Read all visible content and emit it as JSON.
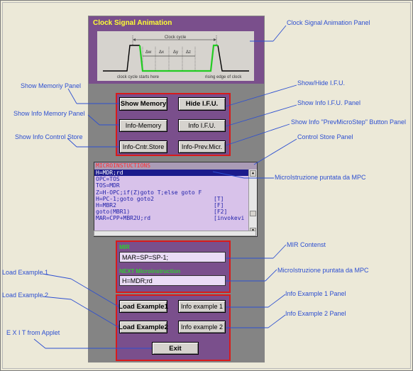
{
  "clock_panel": {
    "title": "Clock Signal Animation",
    "cycle_label": "Clock cycle",
    "delta_labels": [
      "Δw",
      "Δx",
      "Δy",
      "Δz"
    ],
    "start_label": "clock cycle starts here",
    "edge_label": "rising edge of clock"
  },
  "buttons": {
    "show_memory": "Show Memory",
    "hide_ifu": "Hide I.F.U.",
    "info_memory": "Info-Memory",
    "info_ifu": "Info I.F.U.",
    "info_cntr_store": "Info-Cntr.Store",
    "info_prev_micr": "Info-Prev.Micr.",
    "load_example1": "Load Example1",
    "info_example1": "Info example 1",
    "load_example2": "Load Example2",
    "info_example2": "Info example 2",
    "exit": "Exit"
  },
  "control_store": {
    "header": "MICROINSTUCTIONS",
    "rows": [
      {
        "text": "H=MDR;rd",
        "tag": "",
        "selected": true
      },
      {
        "text": "OPC=TOS",
        "tag": "",
        "selected": false
      },
      {
        "text": "TOS=MDR",
        "tag": "",
        "selected": false
      },
      {
        "text": "Z=H-OPC;if(Z)goto T;else goto F",
        "tag": "",
        "selected": false
      },
      {
        "text": "H=PC-1;goto goto2",
        "tag": "[T]",
        "selected": false
      },
      {
        "text": "H=MBR2",
        "tag": "[F]",
        "selected": false
      },
      {
        "text": "goto(MBR1)",
        "tag": "[F2]",
        "selected": false
      },
      {
        "text": "MAR=CPP+MBR2U;rd",
        "tag": "[invokevi",
        "selected": false
      }
    ]
  },
  "mir": {
    "label": "MIR",
    "value": "MAR=SP=SP-1;"
  },
  "next_micro": {
    "label": "NEXT Microinstruction",
    "value": "H=MDR;rd"
  },
  "annotations": {
    "clock_panel": "Clock Signal Animation Panel",
    "show_memory_panel": "Show Memoriy Panel",
    "show_hide_ifu": "Show/Hide I.F.U.",
    "show_info_memory_panel": "Show Info Memory Panel",
    "show_info_ifu_panel": "Show Info I.F.U. Panel",
    "show_info_prev": "Show Info \"PrevMicroStep\" Button Panel",
    "show_info_control_store": "Show Info Control Store",
    "control_store_panel": "Control Store Panel",
    "microistruzione_mpc": "MicroIstruzione puntata da MPC",
    "mir_contenst": "MIR Contenst",
    "microistruzione_mpc2": "MicroIstruzione puntata da MPC",
    "load_example1": "Load Example 1",
    "load_example2": "Load Example 2",
    "info_example1_panel": "Info Example 1 Panel",
    "info_example2_panel": "Info Example 2 Panel",
    "exit_applet": "E X I T from Applet"
  },
  "colors": {
    "panel_purple": "#7a4f8c",
    "accent_red": "#d81b1b",
    "title_yellow": "#ffff33",
    "annotation_blue": "#2d4fd1",
    "signal_green": "#22cc22"
  }
}
